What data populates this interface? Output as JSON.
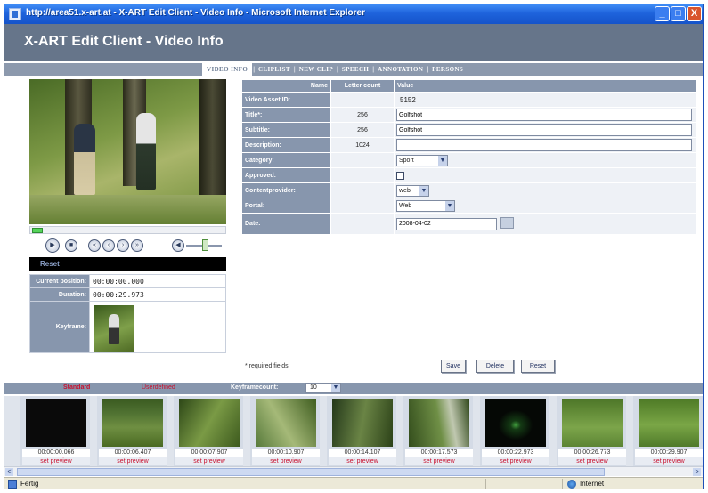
{
  "window": {
    "title": "http://area51.x-art.at - X-ART Edit Client - Video Info - Microsoft Internet Explorer",
    "min_glyph": "_",
    "max_glyph": "□",
    "close_glyph": "X"
  },
  "app": {
    "heading": "X-ART Edit Client - Video Info"
  },
  "tabs": [
    {
      "label": "VIDEO INFO",
      "active": true
    },
    {
      "label": "CLIPLIST",
      "active": false
    },
    {
      "label": "NEW CLIP",
      "active": false
    },
    {
      "label": "SPEECH",
      "active": false
    },
    {
      "label": "ANNOTATION",
      "active": false
    },
    {
      "label": "PERSONS",
      "active": false
    }
  ],
  "tab_separator": "|",
  "player": {
    "progress_fraction": 0.0,
    "volume_fraction": 0.55,
    "buttons": [
      "play",
      "stop",
      "rewind",
      "back",
      "forward",
      "fast-forward",
      "mute"
    ],
    "button_glyphs": {
      "play": "▶",
      "stop": "■",
      "rewind": "«",
      "back": "‹",
      "forward": "›",
      "fast-forward": "»",
      "mute": "◀"
    },
    "reset_label": "Reset"
  },
  "info": {
    "current_position_label": "Current position:",
    "current_position_value": "00:00:00.000",
    "duration_label": "Duration:",
    "duration_value": "00:00:29.973",
    "keyframe_label": "Keyframe:"
  },
  "form": {
    "headers": {
      "name": "Name",
      "count": "Letter count",
      "value": "Value"
    },
    "video_asset_id": {
      "label": "Video Asset ID:",
      "value": "5152"
    },
    "title": {
      "label": "Title*:",
      "count": "256",
      "value": "Golfshot"
    },
    "subtitle": {
      "label": "Subtitle:",
      "count": "256",
      "value": "Golfshot"
    },
    "description": {
      "label": "Description:",
      "count": "1024",
      "value": ""
    },
    "category": {
      "label": "Category:",
      "value": "Sport"
    },
    "approved": {
      "label": "Approved:",
      "checked": false
    },
    "contentprovider": {
      "label": "Contentprovider:",
      "value": "web"
    },
    "portal": {
      "label": "Portal:",
      "value": "Web"
    },
    "date": {
      "label": "Date:",
      "value": "2008-04-02"
    },
    "dropdown_glyph": "▼",
    "required_note": "* required fields",
    "buttons": {
      "save": "Save",
      "delete": "Delete",
      "reset": "Reset"
    }
  },
  "keyframes_bar": {
    "standard_label": "Standard",
    "userdefined_label": "Userdefined",
    "count_label": "Keyframecount:",
    "count_value": "10"
  },
  "keyframes": [
    {
      "time": "00:00:00.066",
      "action": "set preview"
    },
    {
      "time": "00:00:06.407",
      "action": "set preview"
    },
    {
      "time": "00:00:07.907",
      "action": "set preview"
    },
    {
      "time": "00:00:10.907",
      "action": "set preview"
    },
    {
      "time": "00:00:14.107",
      "action": "set preview"
    },
    {
      "time": "00:00:17.573",
      "action": "set preview"
    },
    {
      "time": "00:00:22.973",
      "action": "set preview"
    },
    {
      "time": "00:00:26.773",
      "action": "set preview"
    },
    {
      "time": "00:00:29.907",
      "action": "set preview"
    }
  ],
  "scroll": {
    "left_glyph": "<",
    "right_glyph": ">"
  },
  "status": {
    "left_text": "Fertig",
    "zone_text": "Internet"
  }
}
